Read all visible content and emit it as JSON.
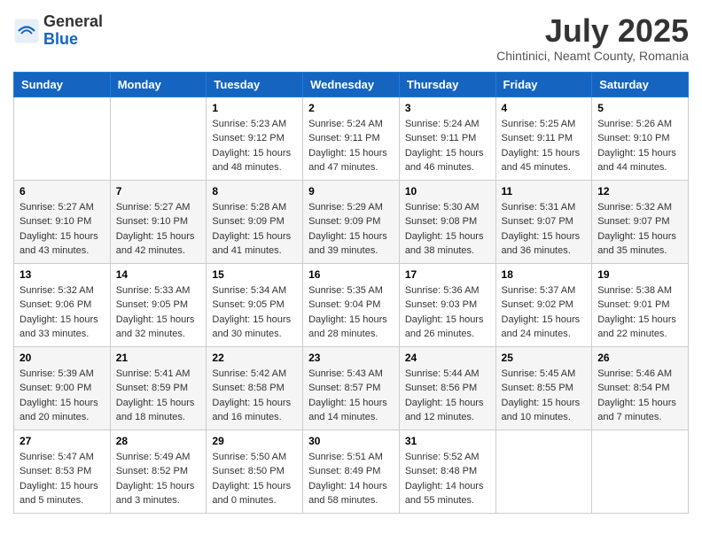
{
  "header": {
    "logo_general": "General",
    "logo_blue": "Blue",
    "month_title": "July 2025",
    "subtitle": "Chintinici, Neamt County, Romania"
  },
  "calendar": {
    "days_of_week": [
      "Sunday",
      "Monday",
      "Tuesday",
      "Wednesday",
      "Thursday",
      "Friday",
      "Saturday"
    ],
    "weeks": [
      [
        {
          "day": "",
          "sunrise": "",
          "sunset": "",
          "daylight": ""
        },
        {
          "day": "",
          "sunrise": "",
          "sunset": "",
          "daylight": ""
        },
        {
          "day": "1",
          "sunrise": "Sunrise: 5:23 AM",
          "sunset": "Sunset: 9:12 PM",
          "daylight": "Daylight: 15 hours and 48 minutes."
        },
        {
          "day": "2",
          "sunrise": "Sunrise: 5:24 AM",
          "sunset": "Sunset: 9:11 PM",
          "daylight": "Daylight: 15 hours and 47 minutes."
        },
        {
          "day": "3",
          "sunrise": "Sunrise: 5:24 AM",
          "sunset": "Sunset: 9:11 PM",
          "daylight": "Daylight: 15 hours and 46 minutes."
        },
        {
          "day": "4",
          "sunrise": "Sunrise: 5:25 AM",
          "sunset": "Sunset: 9:11 PM",
          "daylight": "Daylight: 15 hours and 45 minutes."
        },
        {
          "day": "5",
          "sunrise": "Sunrise: 5:26 AM",
          "sunset": "Sunset: 9:10 PM",
          "daylight": "Daylight: 15 hours and 44 minutes."
        }
      ],
      [
        {
          "day": "6",
          "sunrise": "Sunrise: 5:27 AM",
          "sunset": "Sunset: 9:10 PM",
          "daylight": "Daylight: 15 hours and 43 minutes."
        },
        {
          "day": "7",
          "sunrise": "Sunrise: 5:27 AM",
          "sunset": "Sunset: 9:10 PM",
          "daylight": "Daylight: 15 hours and 42 minutes."
        },
        {
          "day": "8",
          "sunrise": "Sunrise: 5:28 AM",
          "sunset": "Sunset: 9:09 PM",
          "daylight": "Daylight: 15 hours and 41 minutes."
        },
        {
          "day": "9",
          "sunrise": "Sunrise: 5:29 AM",
          "sunset": "Sunset: 9:09 PM",
          "daylight": "Daylight: 15 hours and 39 minutes."
        },
        {
          "day": "10",
          "sunrise": "Sunrise: 5:30 AM",
          "sunset": "Sunset: 9:08 PM",
          "daylight": "Daylight: 15 hours and 38 minutes."
        },
        {
          "day": "11",
          "sunrise": "Sunrise: 5:31 AM",
          "sunset": "Sunset: 9:07 PM",
          "daylight": "Daylight: 15 hours and 36 minutes."
        },
        {
          "day": "12",
          "sunrise": "Sunrise: 5:32 AM",
          "sunset": "Sunset: 9:07 PM",
          "daylight": "Daylight: 15 hours and 35 minutes."
        }
      ],
      [
        {
          "day": "13",
          "sunrise": "Sunrise: 5:32 AM",
          "sunset": "Sunset: 9:06 PM",
          "daylight": "Daylight: 15 hours and 33 minutes."
        },
        {
          "day": "14",
          "sunrise": "Sunrise: 5:33 AM",
          "sunset": "Sunset: 9:05 PM",
          "daylight": "Daylight: 15 hours and 32 minutes."
        },
        {
          "day": "15",
          "sunrise": "Sunrise: 5:34 AM",
          "sunset": "Sunset: 9:05 PM",
          "daylight": "Daylight: 15 hours and 30 minutes."
        },
        {
          "day": "16",
          "sunrise": "Sunrise: 5:35 AM",
          "sunset": "Sunset: 9:04 PM",
          "daylight": "Daylight: 15 hours and 28 minutes."
        },
        {
          "day": "17",
          "sunrise": "Sunrise: 5:36 AM",
          "sunset": "Sunset: 9:03 PM",
          "daylight": "Daylight: 15 hours and 26 minutes."
        },
        {
          "day": "18",
          "sunrise": "Sunrise: 5:37 AM",
          "sunset": "Sunset: 9:02 PM",
          "daylight": "Daylight: 15 hours and 24 minutes."
        },
        {
          "day": "19",
          "sunrise": "Sunrise: 5:38 AM",
          "sunset": "Sunset: 9:01 PM",
          "daylight": "Daylight: 15 hours and 22 minutes."
        }
      ],
      [
        {
          "day": "20",
          "sunrise": "Sunrise: 5:39 AM",
          "sunset": "Sunset: 9:00 PM",
          "daylight": "Daylight: 15 hours and 20 minutes."
        },
        {
          "day": "21",
          "sunrise": "Sunrise: 5:41 AM",
          "sunset": "Sunset: 8:59 PM",
          "daylight": "Daylight: 15 hours and 18 minutes."
        },
        {
          "day": "22",
          "sunrise": "Sunrise: 5:42 AM",
          "sunset": "Sunset: 8:58 PM",
          "daylight": "Daylight: 15 hours and 16 minutes."
        },
        {
          "day": "23",
          "sunrise": "Sunrise: 5:43 AM",
          "sunset": "Sunset: 8:57 PM",
          "daylight": "Daylight: 15 hours and 14 minutes."
        },
        {
          "day": "24",
          "sunrise": "Sunrise: 5:44 AM",
          "sunset": "Sunset: 8:56 PM",
          "daylight": "Daylight: 15 hours and 12 minutes."
        },
        {
          "day": "25",
          "sunrise": "Sunrise: 5:45 AM",
          "sunset": "Sunset: 8:55 PM",
          "daylight": "Daylight: 15 hours and 10 minutes."
        },
        {
          "day": "26",
          "sunrise": "Sunrise: 5:46 AM",
          "sunset": "Sunset: 8:54 PM",
          "daylight": "Daylight: 15 hours and 7 minutes."
        }
      ],
      [
        {
          "day": "27",
          "sunrise": "Sunrise: 5:47 AM",
          "sunset": "Sunset: 8:53 PM",
          "daylight": "Daylight: 15 hours and 5 minutes."
        },
        {
          "day": "28",
          "sunrise": "Sunrise: 5:49 AM",
          "sunset": "Sunset: 8:52 PM",
          "daylight": "Daylight: 15 hours and 3 minutes."
        },
        {
          "day": "29",
          "sunrise": "Sunrise: 5:50 AM",
          "sunset": "Sunset: 8:50 PM",
          "daylight": "Daylight: 15 hours and 0 minutes."
        },
        {
          "day": "30",
          "sunrise": "Sunrise: 5:51 AM",
          "sunset": "Sunset: 8:49 PM",
          "daylight": "Daylight: 14 hours and 58 minutes."
        },
        {
          "day": "31",
          "sunrise": "Sunrise: 5:52 AM",
          "sunset": "Sunset: 8:48 PM",
          "daylight": "Daylight: 14 hours and 55 minutes."
        },
        {
          "day": "",
          "sunrise": "",
          "sunset": "",
          "daylight": ""
        },
        {
          "day": "",
          "sunrise": "",
          "sunset": "",
          "daylight": ""
        }
      ]
    ]
  }
}
